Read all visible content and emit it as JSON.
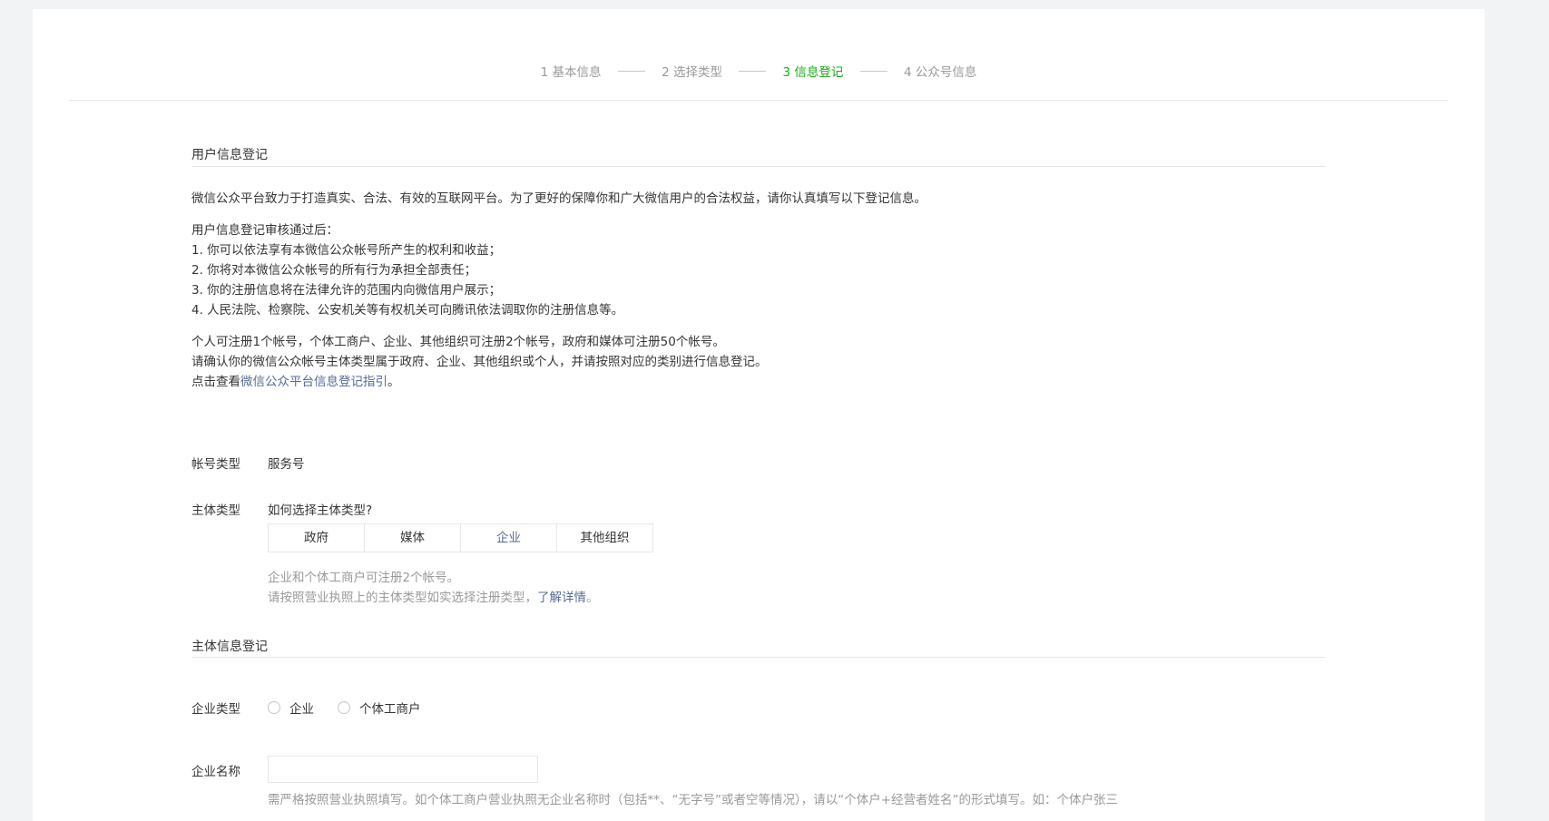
{
  "steps": [
    {
      "label": "1 基本信息",
      "active": false
    },
    {
      "label": "2 选择类型",
      "active": false
    },
    {
      "label": "3 信息登记",
      "active": true
    },
    {
      "label": "4 公众号信息",
      "active": false
    }
  ],
  "user_info": {
    "title": "用户信息登记",
    "intro": "微信公众平台致力于打造真实、合法、有效的互联网平台。为了更好的保障你和广大微信用户的合法权益，请你认真填写以下登记信息。",
    "after_heading": "用户信息登记审核通过后：",
    "list": [
      "1. 你可以依法享有本微信公众帐号所产生的权利和收益；",
      "2. 你将对本微信公众帐号的所有行为承担全部责任；",
      "3. 你的注册信息将在法律允许的范围内向微信用户展示；",
      "4. 人民法院、检察院、公安机关等有权机关可向腾讯依法调取你的注册信息等。"
    ],
    "note_1": "个人可注册1个帐号，个体工商户、企业、其他组织可注册2个帐号，政府和媒体可注册50个帐号。",
    "note_2": "请确认你的微信公众帐号主体类型属于政府、企业、其他组织或个人，并请按照对应的类别进行信息登记。",
    "note_3_prefix": "点击查看",
    "note_3_link": "微信公众平台信息登记指引",
    "note_3_suffix": "。"
  },
  "account_type": {
    "label": "帐号类型",
    "value": "服务号"
  },
  "subject_type": {
    "label": "主体类型",
    "help_link": "如何选择主体类型?",
    "options": [
      "政府",
      "媒体",
      "企业",
      "其他组织"
    ],
    "selected": "企业",
    "tip_1": "企业和个体工商户可注册2个帐号。",
    "tip_2_prefix": "请按照营业执照上的主体类型如实选择注册类型，",
    "tip_2_link": "了解详情",
    "tip_2_suffix": "。"
  },
  "subject_info": {
    "title": "主体信息登记",
    "enterprise_type_label": "企业类型",
    "enterprise_type_options": [
      "企业",
      "个体工商户"
    ],
    "enterprise_name_label": "企业名称",
    "enterprise_name_value": "",
    "enterprise_name_tip": "需严格按照营业执照填写。如个体工商户营业执照无企业名称时（包括**、“无字号”或者空等情况），请以“个体户+经营者姓名”的形式填写。如：个体户张三"
  },
  "colors": {
    "active_step": "#1aad19",
    "link": "#576b95",
    "muted": "#9a9a9a",
    "text": "#353535"
  }
}
